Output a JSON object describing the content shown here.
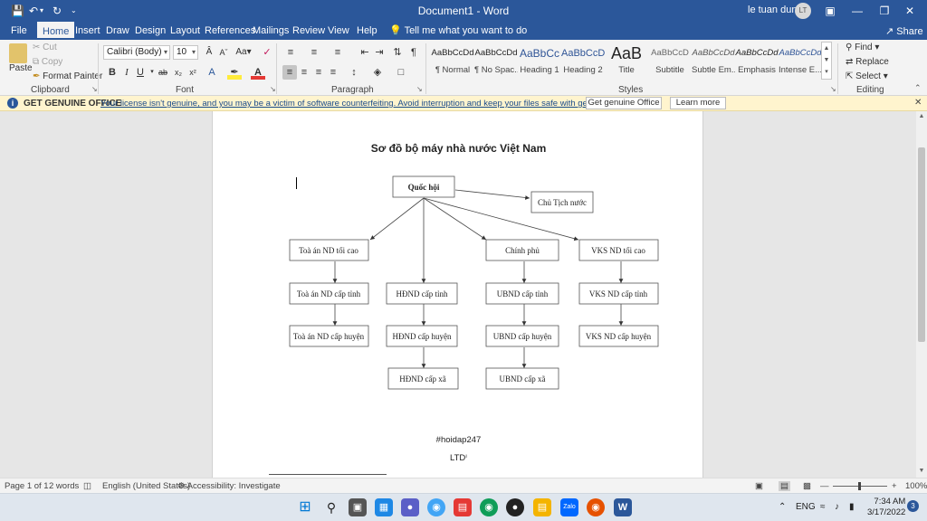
{
  "window": {
    "doc_title": "Document1 - Word",
    "user_name": "le tuan dung",
    "user_initials": "LT"
  },
  "tabs": [
    "File",
    "Home",
    "Insert",
    "Draw",
    "Design",
    "Layout",
    "References",
    "Mailings",
    "Review",
    "View",
    "Help"
  ],
  "tell_me": "Tell me what you want to do",
  "share": "Share",
  "ribbon": {
    "clipboard": {
      "paste": "Paste",
      "cut": "Cut",
      "copy": "Copy",
      "format_painter": "Format Painter",
      "label": "Clipboard"
    },
    "font": {
      "name": "Calibri (Body)",
      "size": "10",
      "label": "Font"
    },
    "paragraph": {
      "label": "Paragraph"
    },
    "styles": {
      "label": "Styles",
      "items": [
        {
          "sample": "AaBbCcDd",
          "name": "¶ Normal"
        },
        {
          "sample": "AaBbCcDd",
          "name": "¶ No Spac..."
        },
        {
          "sample": "AaBbCc",
          "name": "Heading 1"
        },
        {
          "sample": "AaBbCcD",
          "name": "Heading 2"
        },
        {
          "sample": "AaB",
          "name": "Title"
        },
        {
          "sample": "AaBbCcD",
          "name": "Subtitle"
        },
        {
          "sample": "AaBbCcDd",
          "name": "Subtle Em..."
        },
        {
          "sample": "AaBbCcDd",
          "name": "Emphasis"
        },
        {
          "sample": "AaBbCcDd",
          "name": "Intense E..."
        }
      ]
    },
    "editing": {
      "find": "Find",
      "replace": "Replace",
      "select": "Select",
      "label": "Editing"
    }
  },
  "infobar": {
    "title": "GET GENUINE OFFICE",
    "message": "Your license isn't genuine, and you may be a victim of software counterfeiting. Avoid interruption and keep your files safe with genuine Office today.",
    "btn_genuine": "Get genuine Office",
    "btn_learn": "Learn more"
  },
  "document": {
    "heading": "Sơ đồ bộ máy nhà nước Việt Nam",
    "diagram_nodes": {
      "quoc_hoi": "Quốc hội",
      "chu_tich": "Chủ Tịch nước",
      "toa_an_tc": "Toà án ND tối cao",
      "chinh_phu": "Chính phủ",
      "vks_tc": "VKS ND tối cao",
      "toa_an_tinh": "Toà án ND cấp tỉnh",
      "hdnd_tinh": "HĐND cấp tỉnh",
      "ubnd_tinh": "UBND cấp tỉnh",
      "vks_tinh": "VKS ND cấp tỉnh",
      "toa_an_huyen": "Toà án ND cấp huyện",
      "hdnd_huyen": "HĐND cấp huyện",
      "ubnd_huyen": "UBND cấp huyện",
      "vks_huyen": "VKS ND cấp huyện",
      "hdnd_xa": "HĐND cấp xã",
      "ubnd_xa": "UBND cấp xã"
    },
    "tag": "#hoidap247",
    "ltd": "LTDⁱ"
  },
  "status": {
    "page": "Page 1 of 1",
    "words": "2 words",
    "language": "English (United States)",
    "accessibility": "Accessibility: Investigate",
    "zoom": "100%"
  },
  "taskbar": {
    "lang": "ENG",
    "time": "7:34 AM",
    "date": "3/17/2022",
    "notif_count": "3"
  },
  "colors": {
    "word_blue": "#2b579a",
    "info_yellow": "#fff4ce"
  }
}
